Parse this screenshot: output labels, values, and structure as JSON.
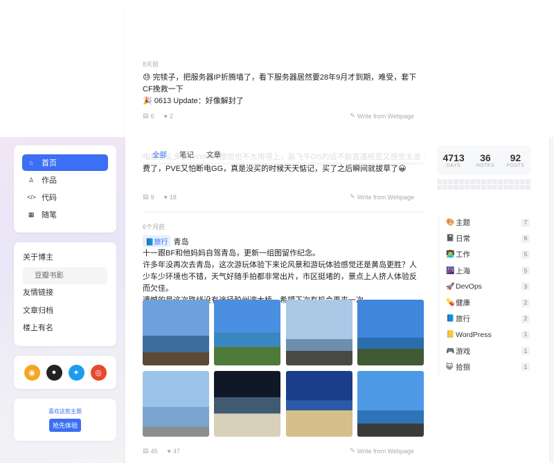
{
  "nav": [
    {
      "label": "首页",
      "icon": "home-icon",
      "glyph": "⌂",
      "active": true
    },
    {
      "label": "作品",
      "icon": "shirt-icon",
      "glyph": "♙",
      "active": false
    },
    {
      "label": "代码",
      "icon": "code-icon",
      "glyph": "</>",
      "active": false
    },
    {
      "label": "随笔",
      "icon": "notebook-icon",
      "glyph": "▦",
      "active": false
    }
  ],
  "links": {
    "about": "关于博主",
    "douban": "豆瓣书影",
    "friends": "友情链接",
    "archive": "文章归档",
    "guestbook": "楼上有名"
  },
  "social": [
    {
      "icon": "rss-icon",
      "color": "#f5a623",
      "glyph": "◉"
    },
    {
      "icon": "github-icon",
      "color": "#222222",
      "glyph": "●"
    },
    {
      "icon": "twitter-icon",
      "color": "#1d9bf0",
      "glyph": "✦"
    },
    {
      "icon": "weibo-icon",
      "color": "#e6492e",
      "glyph": "◎"
    }
  ],
  "promo": {
    "text": "喜欢这款主题",
    "button": "抢先体验"
  },
  "tabs": [
    "全部",
    "笔记",
    "文章"
  ],
  "posts": [
    {
      "time": "8天前",
      "lines": [
        "😓 完犊子，把服务器IP折腾墙了，看下服务器居然要28年9月才到期，难受，套下CF挽救一下",
        "🎉 0613 Update：好像解封了"
      ],
      "comments": "6",
      "likes": "2",
      "source": "Write from Webpage"
    },
    {
      "lines": [
        "电脑那么多装Windows感觉也不太用得上，装飞牛OS的话不能直通核显又感觉太浪费了，PVE又怕断电GG，真是没买的时候天天惦记，买了之后瞬间就拔草了😀"
      ],
      "comments": "9",
      "likes": "18",
      "source": "Write from Webpage"
    },
    {
      "time": "6个月前",
      "tag": "📘旅行",
      "title": "青岛",
      "lines": [
        "十一跟BF和他妈妈自驾青岛，更新一组图留作纪念。",
        "许多年没再次去青岛，这次游玩体验下来论风景和游玩体验感觉还是黄岛更胜？人少车少环境也不错，天气好随手拍都非常出片，市区挺堵的，景点上人挤人体验反而欠佳。",
        "遗憾的是这次路线没有途径胶州湾大桥，希望下次有机会再来一次。"
      ],
      "comments": "45",
      "likes": "47",
      "source": "Write from Webpage"
    }
  ],
  "stats": [
    {
      "value": "4713",
      "label": "DAYS"
    },
    {
      "value": "36",
      "label": "NOTES"
    },
    {
      "value": "92",
      "label": "POSTS"
    }
  ],
  "categories": [
    {
      "emoji": "🎨",
      "name": "主题",
      "count": "7"
    },
    {
      "emoji": "📓",
      "name": "日常",
      "count": "6"
    },
    {
      "emoji": "👨‍💻",
      "name": "工作",
      "count": "5"
    },
    {
      "emoji": "🌆",
      "name": "上海",
      "count": "5"
    },
    {
      "emoji": "🚀",
      "name": "DevOps",
      "count": "3"
    },
    {
      "emoji": "💊",
      "name": "健康",
      "count": "2"
    },
    {
      "emoji": "📘",
      "name": "旅行",
      "count": "2"
    },
    {
      "emoji": "📒",
      "name": "WordPress",
      "count": "1"
    },
    {
      "emoji": "🎮",
      "name": "游戏",
      "count": "1"
    },
    {
      "emoji": "😺",
      "name": "拾捌",
      "count": "1"
    }
  ],
  "icons": {
    "comment": "comment-icon",
    "like": "heart-icon",
    "source": "edit-icon"
  },
  "photos": [
    {
      "sky": "#6ea0dc",
      "sea": "#3f6e9e",
      "land": "#5c4a36"
    },
    {
      "sky": "#4a8fe0",
      "sea": "#3a88c2",
      "land": "#4e7a3a"
    },
    {
      "sky": "#a9c9e6",
      "sea": "#6c8fb0",
      "land": "#4a4a42"
    },
    {
      "sky": "#3f86dc",
      "sea": "#2b6eae",
      "land": "#3f5a35"
    },
    {
      "sky": "#9cc4ea",
      "sea": "#7aa6cf",
      "land": "#8a8e90"
    },
    {
      "sky": "#101828",
      "sea": "#405a72",
      "land": "#d8d0b8"
    },
    {
      "sky": "#1a3e8a",
      "sea": "#2d5aa8",
      "land": "#d6bf8a"
    },
    {
      "sky": "#4e9ae6",
      "sea": "#2e74b6",
      "land": "#3a3c3c"
    }
  ],
  "heatmap_active": [
    40,
    41,
    42
  ]
}
